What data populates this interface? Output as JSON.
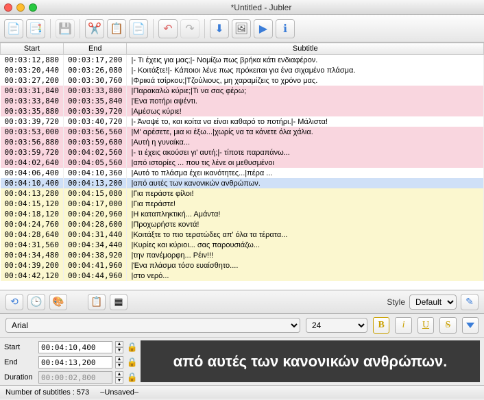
{
  "window": {
    "title": "*Untitled - Jubler"
  },
  "columns": {
    "start": "Start",
    "end": "End",
    "subtitle": "Subtitle"
  },
  "rows": [
    {
      "start": "00:03:12,880",
      "end": "00:03:17,200",
      "text": "|- Τι έχεις για μας;|- Νομίζω πως βρήκα κάτι ενδιαφέρον.",
      "cls": "white"
    },
    {
      "start": "00:03:20,440",
      "end": "00:03:26,080",
      "text": "|- Κοιτάξτε!|- Κάποιοι λένε πως πρόκειται για ένα σιχαμένο πλάσμα.",
      "cls": "white"
    },
    {
      "start": "00:03:27,200",
      "end": "00:03:30,760",
      "text": "|Φρικιά τσίρκου;|Τζούλιους, μη χαραμίζεις το χρόνο μας.",
      "cls": "white"
    },
    {
      "start": "00:03:31,840",
      "end": "00:03:33,800",
      "text": "|Παρακαλώ κύριε;|Τι να σας φέρω;",
      "cls": "pink"
    },
    {
      "start": "00:03:33,840",
      "end": "00:03:35,840",
      "text": "|Ένα ποτήρι αψέντι.",
      "cls": "pink"
    },
    {
      "start": "00:03:35,880",
      "end": "00:03:39,720",
      "text": "|Αμέσως κύριε!",
      "cls": "pink"
    },
    {
      "start": "00:03:39,720",
      "end": "00:03:40,720",
      "text": "|- Άναψέ το, και κοίτα να είναι καθαρό το ποτήρι.|- Μάλιστα!",
      "cls": "white"
    },
    {
      "start": "00:03:53,000",
      "end": "00:03:56,560",
      "text": "|Μ' αρέσετε, μια κι έξω...|χωρίς να τα κάνετε όλα χάλια.",
      "cls": "pink"
    },
    {
      "start": "00:03:56,880",
      "end": "00:03:59,680",
      "text": "|Αυτή η γυναίκα...",
      "cls": "pink"
    },
    {
      "start": "00:03:59,720",
      "end": "00:04:02,560",
      "text": "|- τι έχεις ακούσει γι' αυτή;|- τίποτε παραπάνω...",
      "cls": "pink"
    },
    {
      "start": "00:04:02,640",
      "end": "00:04:05,560",
      "text": "|από ιστορίες ... που τις λένε οι μεθυσμένοι",
      "cls": "pink"
    },
    {
      "start": "00:04:06,400",
      "end": "00:04:10,360",
      "text": "|Αυτό το πλάσμα έχει ικανότητες...|πέρα ...",
      "cls": "white"
    },
    {
      "start": "00:04:10,400",
      "end": "00:04:13,200",
      "text": "|από αυτές των κανονικών ανθρώπων.",
      "cls": "blue"
    },
    {
      "start": "00:04:13,280",
      "end": "00:04:15,080",
      "text": "|Για περάστε φίλοι!",
      "cls": "yellow"
    },
    {
      "start": "00:04:15,120",
      "end": "00:04:17,000",
      "text": "|Για περάστε!",
      "cls": "yellow"
    },
    {
      "start": "00:04:18,120",
      "end": "00:04:20,960",
      "text": "|Η καταπληκτική... Αμάντα!",
      "cls": "yellow"
    },
    {
      "start": "00:04:24,760",
      "end": "00:04:28,600",
      "text": "|Προχωρήστε κοντά!",
      "cls": "yellow"
    },
    {
      "start": "00:04:28,640",
      "end": "00:04:31,440",
      "text": "|Κοιτάξτε το πιο τερατώδες απ' όλα τα τέρατα...",
      "cls": "yellow"
    },
    {
      "start": "00:04:31,560",
      "end": "00:04:34,440",
      "text": "|Κυρίες και κύριοι... σας παρουσιάζω...",
      "cls": "yellow"
    },
    {
      "start": "00:04:34,480",
      "end": "00:04:38,920",
      "text": "|την πανέμορφη... Ρέιν!!!",
      "cls": "yellow"
    },
    {
      "start": "00:04:39,200",
      "end": "00:04:41,960",
      "text": "|Ένα πλάσμα τόσο ευαίσθητο....",
      "cls": "yellow"
    },
    {
      "start": "00:04:42,120",
      "end": "00:04:44,960",
      "text": "|στο νερό...",
      "cls": "yellow"
    }
  ],
  "style": {
    "label": "Style",
    "value": "Default"
  },
  "font": {
    "family": "Arial",
    "size": "24"
  },
  "format_buttons": {
    "bold": "B",
    "italic": "i",
    "underline": "U",
    "strike": "S"
  },
  "time": {
    "start_label": "Start",
    "start": "00:04:10,400",
    "end_label": "End",
    "end": "00:04:13,200",
    "duration_label": "Duration",
    "duration": "00:00:02,800"
  },
  "preview": "από αυτές των κανονικών ανθρώπων.",
  "status": {
    "count_label": "Number of subtitles : 573",
    "saved": "–Unsaved–"
  }
}
